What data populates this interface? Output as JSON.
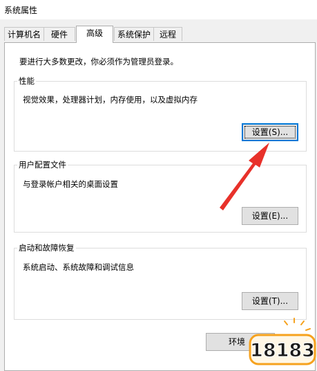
{
  "window": {
    "title": "系统属性"
  },
  "tabs": [
    {
      "label": "计算机名"
    },
    {
      "label": "硬件"
    },
    {
      "label": "高级",
      "active": true
    },
    {
      "label": "系统保护"
    },
    {
      "label": "远程"
    }
  ],
  "advanced": {
    "admin_notice": "要进行大多数更改，你必须作为管理员登录。",
    "performance": {
      "title": "性能",
      "description": "视觉效果，处理器计划，内存使用，以及虚拟内存",
      "settings_button": "设置(S)..."
    },
    "user_profiles": {
      "title": "用户配置文件",
      "description": "与登录帐户相关的桌面设置",
      "settings_button": "设置(E)..."
    },
    "startup_recovery": {
      "title": "启动和故障恢复",
      "description": "系统启动、系统故障和调试信息",
      "settings_button": "设置(T)..."
    },
    "environment_button": "环境"
  },
  "watermark": {
    "text": "18183"
  },
  "colors": {
    "annotation_arrow": "#e8312a",
    "focus_border": "#0078d7",
    "logo_accent": "#f6a21e"
  }
}
